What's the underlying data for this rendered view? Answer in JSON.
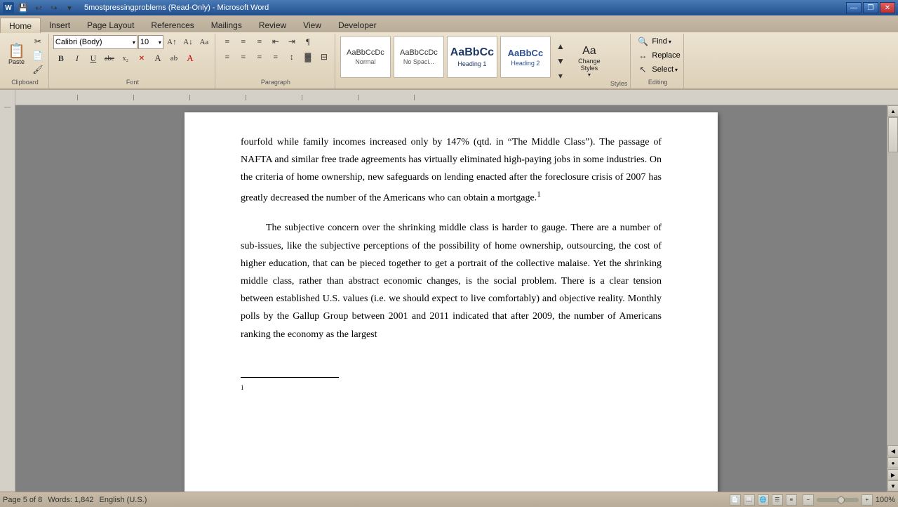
{
  "window": {
    "title": "5mostpressingproblems (Read-Only) - Microsoft Word",
    "app_name": "W"
  },
  "title_bar": {
    "title": "5mostpressingproblems (Read-Only) - Microsoft Word",
    "minimize": "—",
    "restore": "❐",
    "close": "✕"
  },
  "ribbon": {
    "tabs": [
      "Home",
      "Insert",
      "Page Layout",
      "References",
      "Mailings",
      "Review",
      "View",
      "Developer"
    ],
    "active_tab": "Home",
    "groups": {
      "clipboard": {
        "label": "Clipboard",
        "paste_label": "Paste"
      },
      "font": {
        "label": "Font",
        "font_name": "Calibri (Body)",
        "font_size": "10",
        "bold": "B",
        "italic": "I",
        "underline": "U",
        "strikethrough": "abc",
        "subscript": "x₂",
        "clear": "✕",
        "text_effects": "A",
        "highlight": "ab",
        "font_color": "A"
      },
      "paragraph": {
        "label": "Paragraph",
        "bullets": "≡",
        "numbering": "≡",
        "multilevel": "≡",
        "decrease_indent": "⇤",
        "increase_indent": "⇥",
        "show_hide": "¶",
        "align_left": "≡",
        "align_center": "≡",
        "align_right": "≡",
        "justify": "≡",
        "line_spacing": "↕",
        "shading": "▓",
        "borders": "⊟"
      },
      "styles": {
        "label": "Styles",
        "normal_label": "Normal",
        "normal_sublabel": "Normal",
        "no_spacing_label": "No Spaci...",
        "heading1_label": "Heading 1",
        "heading1_text": "Heading 1",
        "heading2_label": "Heading 2",
        "heading2_text": "Heading",
        "change_styles_label": "Change\nStyles",
        "change_styles_arrow": "▾"
      },
      "editing": {
        "label": "Editing",
        "find_label": "Find",
        "replace_label": "Replace",
        "select_label": "Select"
      }
    }
  },
  "document": {
    "paragraphs": [
      {
        "text": "fourfold while family incomes increased only by 147% (qtd. in “The Middle Class”).  The passage of NAFTA and similar  free trade agreements has virtually eliminated high-paying jobs in some industries.  On the criteria of home ownership, new safeguards on lending enacted after the foreclosure crisis of 2007 has greatly decreased the number of the Americans who can obtain a mortgage.",
        "superscript": "1",
        "type": "normal"
      },
      {
        "text": "The subjective concern over the shrinking middle class is harder to gauge.  There are a number of sub-issues, like the subjective perceptions of the possibility of home ownership, outsourcing, the cost of higher education, that can be pieced together to get a portrait of the collective malaise.  Yet the shrinking middle class, rather than abstract economic changes, is the social problem.  There is a clear tension between established U.S. values (i.e. we should expect to live comfortably) and objective reality.  Monthly polls by the Gallup Group between 2001 and 2011 indicated that after 2009, the number of Americans ranking the economy as the largest",
        "type": "indented"
      }
    ],
    "footnote_number": "1"
  },
  "status_bar": {
    "page": "Page 5 of 8",
    "words": "Words: 1,842",
    "language": "English (U.S.)"
  }
}
